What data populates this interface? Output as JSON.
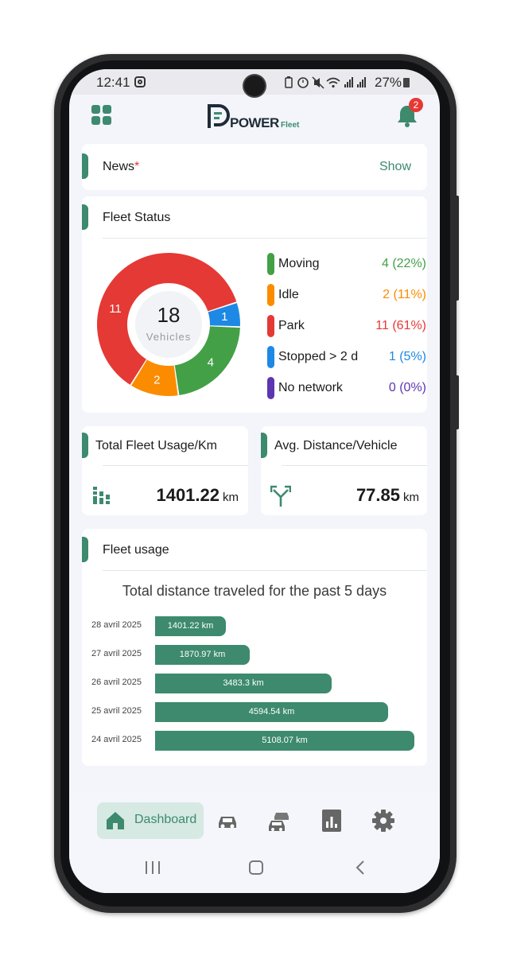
{
  "status_bar": {
    "time": "12:41",
    "battery": "27%",
    "icons": [
      "instagram-icon",
      "battery-saver-icon",
      "alarm-icon",
      "mute-icon",
      "wifi-icon",
      "signal-icon",
      "signal-icon"
    ]
  },
  "header": {
    "logo_power": "POWER",
    "logo_fleet": "Fleet",
    "notification_count": "2"
  },
  "news": {
    "title": "News",
    "required_mark": "*",
    "show_label": "Show"
  },
  "fleet_status": {
    "title": "Fleet  Status",
    "total": "18",
    "total_label": "Vehicles",
    "slice_labels": {
      "park": "11",
      "stopped": "1",
      "moving": "4",
      "idle": "2"
    },
    "legend": [
      {
        "label": "Moving",
        "value": "4 (22%)",
        "color": "#43a047"
      },
      {
        "label": "Idle",
        "value": "2 (11%)",
        "color": "#fb8c00"
      },
      {
        "label": "Park",
        "value": "11 (61%)",
        "color": "#e53935"
      },
      {
        "label": "Stopped > 2 d",
        "value": "1 (5%)",
        "color": "#1e88e5"
      },
      {
        "label": "No network",
        "value": "0 (0%)",
        "color": "#5e35b1"
      }
    ]
  },
  "total_usage": {
    "title": "Total Fleet Usage/Km",
    "value": "1401.22",
    "unit": "km"
  },
  "avg_distance": {
    "title": "Avg. Distance/Vehicle",
    "value": "77.85",
    "unit": "km"
  },
  "fleet_usage": {
    "title": "Fleet usage"
  },
  "chart_data": [
    {
      "type": "pie",
      "labels": [
        "Moving",
        "Idle",
        "Park",
        "Stopped > 2 d",
        "No network"
      ],
      "values": [
        4,
        2,
        11,
        1,
        0
      ],
      "colors": [
        "#43a047",
        "#fb8c00",
        "#e53935",
        "#1e88e5",
        "#5e35b1"
      ]
    },
    {
      "type": "bar",
      "orientation": "horizontal",
      "title": "Total distance traveled for the past 5 days",
      "categories": [
        "28 avril 2025",
        "27 avril 2025",
        "26 avril 2025",
        "25 avril 2025",
        "24 avril 2025"
      ],
      "values": [
        1401.22,
        1870.97,
        3483.3,
        4594.54,
        5108.07
      ],
      "value_labels": [
        "1401.22 km",
        "1870.97 km",
        "3483.3 km",
        "4594.54 km",
        "5108.07 km"
      ],
      "color": "#3d8a6e"
    }
  ],
  "bottom_nav": {
    "active_label": "Dashboard",
    "items": [
      "home-icon",
      "car-icon",
      "fleet-cars-icon",
      "reports-icon",
      "settings-icon"
    ]
  }
}
